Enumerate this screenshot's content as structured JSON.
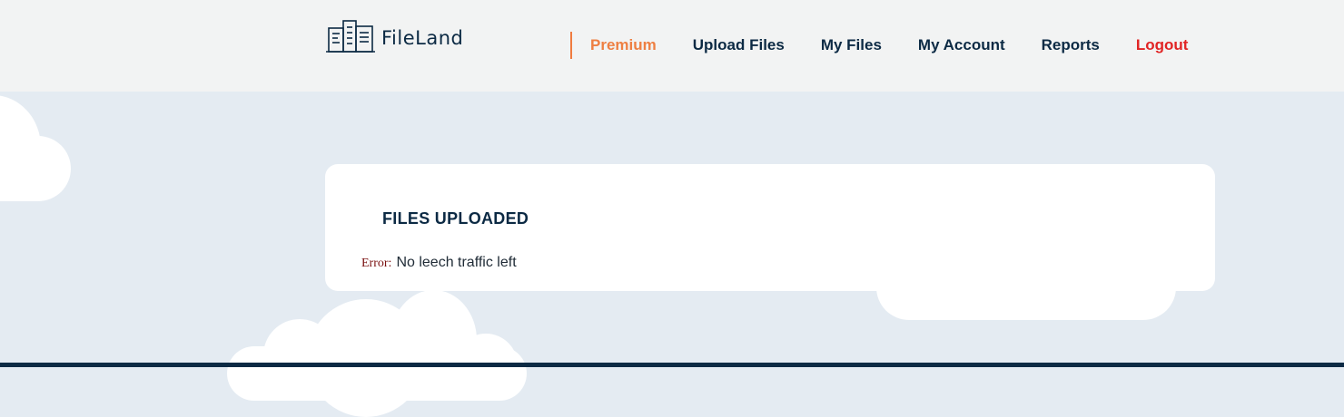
{
  "brand": {
    "name": "FileLand",
    "logo_icon": "server-buildings-icon"
  },
  "nav": {
    "items": [
      {
        "label": "Premium",
        "color": "#ee7f42"
      },
      {
        "label": "Upload Files",
        "color": "#0c2a44"
      },
      {
        "label": "My Files",
        "color": "#0c2a44"
      },
      {
        "label": "My Account",
        "color": "#0c2a44"
      },
      {
        "label": "Reports",
        "color": "#0c2a44"
      },
      {
        "label": "Logout",
        "color": "#e12424"
      }
    ]
  },
  "card": {
    "title": "FILES UPLOADED",
    "error_label": "Error:",
    "error_message": "No leech traffic left"
  },
  "colors": {
    "header_bg": "#f2f3f3",
    "page_bg": "#e4ebf2",
    "accent": "#ee7f42",
    "brand_navy": "#0c2a44",
    "danger": "#e12424"
  }
}
